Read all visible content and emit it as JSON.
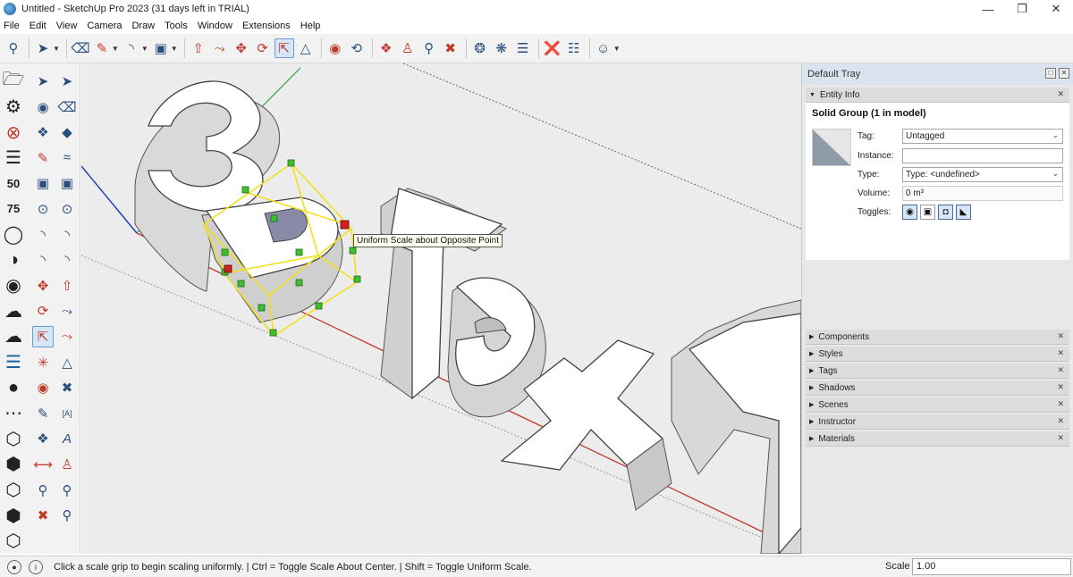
{
  "window": {
    "title": "Untitled - SketchUp Pro 2023 (31 days left in TRIAL)",
    "minimize": "—",
    "restore": "❐",
    "close": "✕"
  },
  "menubar": {
    "items": [
      "File",
      "Edit",
      "View",
      "Camera",
      "Draw",
      "Tools",
      "Window",
      "Extensions",
      "Help"
    ]
  },
  "toolbar": {
    "icons": [
      "search-icon",
      "select-icon",
      "eraser-icon",
      "pencil-icon",
      "arc-icon",
      "rectangle-icon",
      "push-pull-icon",
      "follow-me-icon",
      "move-icon",
      "rotate-icon",
      "scale-icon",
      "offset-icon",
      "paint-icon",
      "orbit-icon",
      "pan-icon",
      "walk-icon",
      "zoom-icon",
      "zoom-extents-icon",
      "warehouse-icon",
      "extension-icon",
      "layers-icon",
      "account-icon"
    ]
  },
  "viewport": {
    "tooltip": "Uniform Scale about Opposite Point",
    "model_text": "3D Text"
  },
  "tray": {
    "title": "Default Tray",
    "entity_info": {
      "header": "Entity Info",
      "title": "Solid Group (1 in model)",
      "tag_label": "Tag:",
      "tag_value": "Untagged",
      "instance_label": "Instance:",
      "instance_value": "",
      "type_label": "Type:",
      "type_value": "Type: <undefined>",
      "volume_label": "Volume:",
      "volume_value": "0 m³",
      "toggles_label": "Toggles:"
    },
    "panels": [
      "Components",
      "Styles",
      "Tags",
      "Shadows",
      "Scenes",
      "Instructor",
      "Materials"
    ]
  },
  "statusbar": {
    "message": "Click a scale grip to begin scaling uniformly. | Ctrl = Toggle Scale About Center. | Shift = Toggle Uniform Scale.",
    "scale_label": "Scale",
    "scale_value": "1.00"
  },
  "colors": {
    "selection": "#f2e020",
    "grip": "#3fbf2f",
    "grip_active": "#d02020",
    "axis_red": "#c0392b",
    "axis_green": "#2fa043",
    "axis_blue": "#2340b0"
  }
}
